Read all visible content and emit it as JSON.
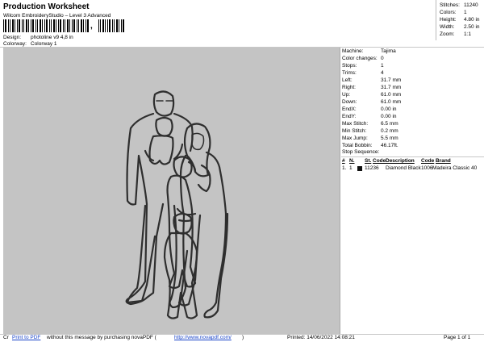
{
  "header": {
    "title": "Production Worksheet",
    "software": "Wilcom EmbroideryStudio – Level 3 Advanced",
    "barcode_char": ",",
    "design_label": "Design:",
    "design_value": "photoline v9 4,8 in",
    "colorway_label": "Colorway:",
    "colorway_value": "Colorway 1"
  },
  "summary": {
    "stitches_label": "Stitches:",
    "stitches_value": "11240",
    "colors_label": "Colors:",
    "colors_value": "1",
    "height_label": "Height:",
    "height_value": "4.80 in",
    "width_label": "Width:",
    "width_value": "2.50 in",
    "zoom_label": "Zoom:",
    "zoom_value": "1:1"
  },
  "details": [
    {
      "label": "Machine:",
      "value": "Tajima"
    },
    {
      "label": "Color changes:",
      "value": "0"
    },
    {
      "label": "Stops:",
      "value": "1"
    },
    {
      "label": "Trims:",
      "value": "4"
    },
    {
      "label": "Left:",
      "value": "31.7 mm"
    },
    {
      "label": "Right:",
      "value": "31.7 mm"
    },
    {
      "label": "Up:",
      "value": "61.0 mm"
    },
    {
      "label": "Down:",
      "value": "61.0 mm"
    },
    {
      "label": "EndX:",
      "value": "0.00 in"
    },
    {
      "label": "EndY:",
      "value": "0.00 in"
    },
    {
      "label": "Max Stitch:",
      "value": "6.5 mm"
    },
    {
      "label": "Min Stitch:",
      "value": "0.2 mm"
    },
    {
      "label": "Max Jump:",
      "value": "5.5 mm"
    },
    {
      "label": "Total Bobbin:",
      "value": "46.17ft."
    }
  ],
  "stop_sequence": {
    "title": "Stop Sequence:",
    "headers": [
      "#",
      "N.",
      "St.",
      "Code",
      "Description",
      "Code",
      "Brand"
    ],
    "rows": [
      {
        "num": "1.",
        "needle": "1",
        "stitches": "11236",
        "color": "#111111",
        "desc": "Diamond Black",
        "code": "1006",
        "brand": "Madeira Classic 40"
      }
    ]
  },
  "footer": {
    "prefix": "Cr",
    "link_text": "Print to PDF",
    "middle": " without this message by purchasing novaPDF (",
    "url": "http://www.novapdf.com/",
    "suffix": ")",
    "printed": "Printed: 14/06/2022 14:08:21",
    "page": "Page 1 of 1"
  }
}
